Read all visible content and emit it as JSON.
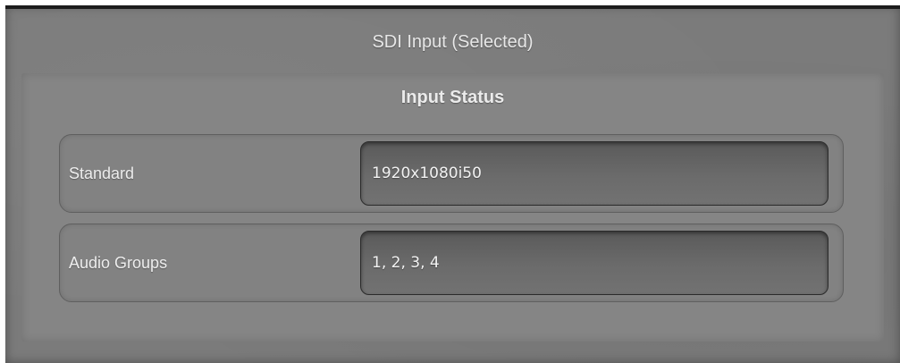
{
  "panel": {
    "title": "SDI Input (Selected)"
  },
  "input_status": {
    "section_title": "Input Status",
    "rows": [
      {
        "label": "Standard",
        "value": "1920x1080i50"
      },
      {
        "label": "Audio Groups",
        "value": "1, 2, 3, 4"
      }
    ]
  }
}
